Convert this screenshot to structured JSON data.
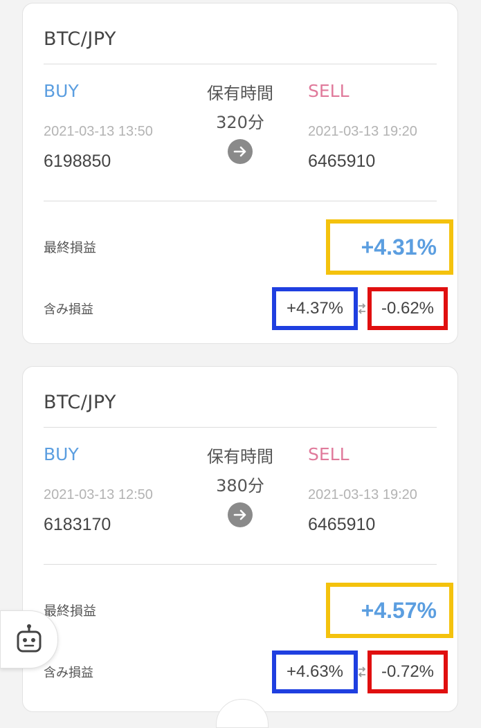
{
  "trades": [
    {
      "pair": "BTC/JPY",
      "buy_label": "BUY",
      "sell_label": "SELL",
      "hold_label": "保有時間",
      "hold_value": "320分",
      "buy_time": "2021-03-13 13:50",
      "sell_time": "2021-03-13 19:20",
      "buy_price": "6198850",
      "sell_price": "6465910",
      "final_label": "最終損益",
      "final_pl": "+4.31%",
      "unrealized_label": "含み損益",
      "unrealized_a": "+4.37%",
      "unrealized_b": "-0.62%"
    },
    {
      "pair": "BTC/JPY",
      "buy_label": "BUY",
      "sell_label": "SELL",
      "hold_label": "保有時間",
      "hold_value": "380分",
      "buy_time": "2021-03-13 12:50",
      "sell_time": "2021-03-13 19:20",
      "buy_price": "6183170",
      "sell_price": "6465910",
      "final_label": "最終損益",
      "final_pl": "+4.57%",
      "unrealized_label": "含み損益",
      "unrealized_a": "+4.63%",
      "unrealized_b": "-0.72%"
    }
  ],
  "icons": {
    "arrow": "arrow-right-icon",
    "swap": "swap-icon",
    "bot": "robot-icon"
  },
  "colors": {
    "buy": "#5b9ee0",
    "sell": "#e07a9b",
    "highlight_final": "#f4c20d",
    "highlight_a": "#1f3fe0",
    "highlight_b": "#e00f0f"
  }
}
